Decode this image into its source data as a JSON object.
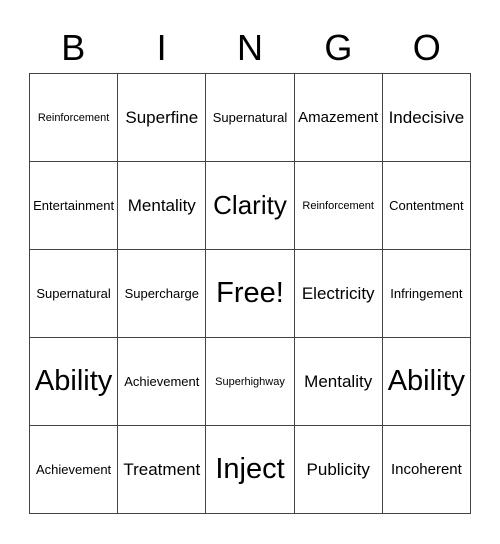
{
  "header": {
    "letters": [
      "B",
      "I",
      "N",
      "G",
      "O"
    ]
  },
  "board": {
    "rows": [
      [
        "Reinforcement",
        "Superfine",
        "Supernatural",
        "Amazement",
        "Indecisive"
      ],
      [
        "Entertainment",
        "Mentality",
        "Clarity",
        "Reinforcement",
        "Contentment"
      ],
      [
        "Supernatural",
        "Supercharge",
        "Free!",
        "Electricity",
        "Infringement"
      ],
      [
        "Ability",
        "Achievement",
        "Superhighway",
        "Mentality",
        "Ability"
      ],
      [
        "Achievement",
        "Treatment",
        "Inject",
        "Publicity",
        "Incoherent"
      ]
    ],
    "free_space": "Free!"
  }
}
